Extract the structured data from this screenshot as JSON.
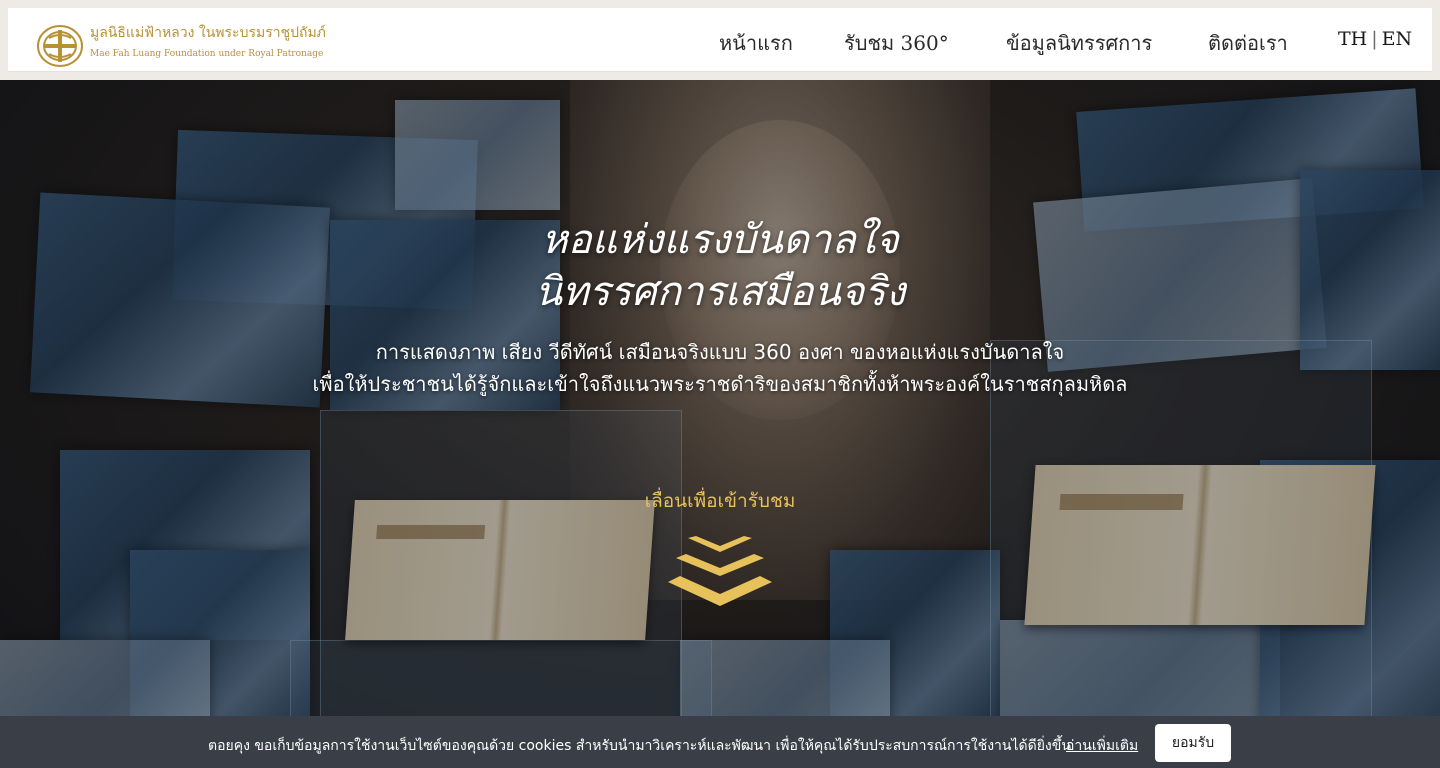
{
  "header": {
    "brand_th": "มูลนิธิแม่ฟ้าหลวง ในพระบรมราชูปถัมภ์",
    "brand_en": "Mae Fah Luang Foundation under Royal Patronage",
    "nav": [
      "หน้าแรก",
      "รับชม 360°",
      "ข้อมูลนิทรรศการ",
      "ติดต่อเรา"
    ],
    "lang_th": "TH",
    "lang_sep": "|",
    "lang_en": "EN",
    "logo_icon": "foundation-emblem-icon"
  },
  "hero": {
    "title_line1": "หอแห่งแรงบันดาลใจ",
    "title_line2": "นิทรรศการเสมือนจริง",
    "subtitle_line1": "การแสดงภาพ เสียง วีดีทัศน์ เสมือนจริงแบบ 360 องศา ของหอแห่งแรงบันดาลใจ",
    "subtitle_line2": "เพื่อให้ประชาชนได้รู้จักและเข้าใจถึงแนวพระราชดำริของสมาชิกทั้งห้าพระองค์ในราชสกุลมหิดล",
    "scroll_label": "เลื่อนเพื่อเข้ารับชม",
    "scroll_icon": "chevrons-down-icon"
  },
  "cookie": {
    "text": "ตอยคุง ขอเก็บข้อมูลการใช้งานเว็บไซต์ของคุณด้วย cookies สำหรับนำมาวิเคราะห์และพัฒนา เพื่อให้คุณได้รับประสบการณ์การใช้งานได้ดียิ่งขึ้น",
    "link": "อ่านเพิ่มเติม",
    "accept": "ยอมรับ"
  },
  "colors": {
    "gold": "#b89136",
    "accent_yellow": "#e7c15a",
    "cookie_bg": "#3a3f47"
  }
}
